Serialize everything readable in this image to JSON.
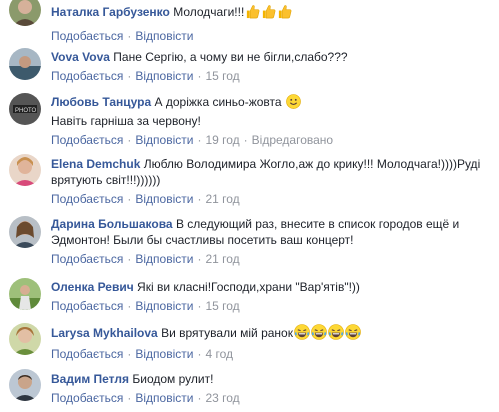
{
  "actions": {
    "like": "Подобається",
    "reply": "Відповісти",
    "edited": "Відредаговано"
  },
  "comments": [
    {
      "author": "Наталка Гарбузенко",
      "text": "Молодчаги!!!",
      "emoji": [
        "thumbs-up-icon",
        "thumbs-up-icon",
        "thumbs-up-icon"
      ],
      "time": ""
    },
    {
      "author": "Vova Vova",
      "text": "Пане Сергію, а чому ви не бігли,слабо???",
      "time": "15 год"
    },
    {
      "author": "Любовь Танцура",
      "text": "А доріжка синьо-жовта",
      "emoji": [
        "smile-icon"
      ],
      "text2": "Навіть гарніша за червону!",
      "time": "19 год"
    },
    {
      "author": "Elena Demchuk",
      "text": "Люблю Володимира Жогло,аж до крику!!! Молодчага!))))Руді врятують світ!!!))))))",
      "time": "21 год"
    },
    {
      "author": "Дарина Большакова",
      "text": "В следующий раз, внесите в список городов ещё и Эдмонтон! Были бы счастливы посетить ваш концерт!",
      "time": "21 год"
    },
    {
      "author": "Оленка Ревич",
      "text": "Які ви класні!Господи,храни \"Вар'ятів\"!))",
      "time": "15 год"
    },
    {
      "author": "Larysa Mykhailova",
      "text": "Ви врятували мій ранок",
      "emoji": [
        "laughing-icon",
        "laughing-icon",
        "laughing-icon",
        "laughing-icon"
      ],
      "time": "4 год"
    },
    {
      "author": "Вадим Петля",
      "text": "Биодом рулит!",
      "time": "23 год"
    }
  ]
}
